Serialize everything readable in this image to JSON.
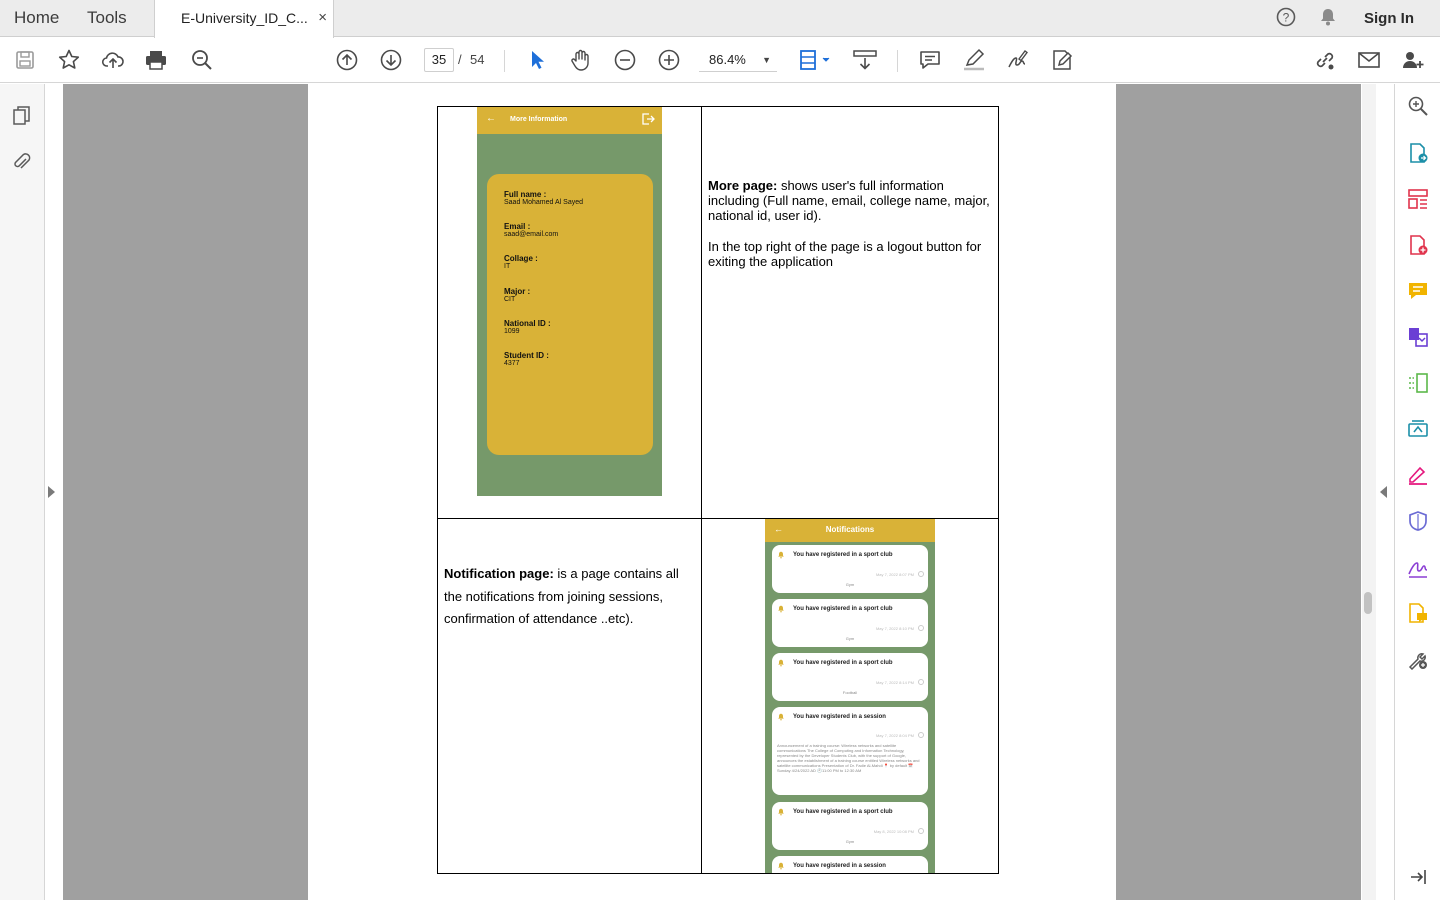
{
  "tabbar": {
    "home_label": "Home",
    "tools_label": "Tools",
    "doc_tab_label": "E-University_ID_C...",
    "close_glyph": "×",
    "sign_in_label": "Sign In",
    "icons": [
      "help-icon",
      "notifications-bell-icon"
    ]
  },
  "toolbar": {
    "current_page": "35",
    "page_separator": "/",
    "total_pages": "54",
    "zoom_level": "86.4%",
    "zoom_dropdown_glyph": "▼",
    "icons": [
      "save-icon",
      "bookmark-star-icon",
      "upload-cloud-icon",
      "print-icon",
      "zoom-search-icon",
      "prev-page-icon",
      "next-page-icon",
      "select-pointer-icon",
      "hand-tool-icon",
      "zoom-out-icon",
      "zoom-in-icon",
      "page-fit-icon",
      "scroll-mode-icon",
      "comment-icon",
      "highlight-icon",
      "sign-icon",
      "edit-icon",
      "share-link-icon",
      "email-icon",
      "add-user-icon"
    ]
  },
  "left_nav": {
    "icons": [
      "page-thumbnails-icon",
      "attachments-icon"
    ]
  },
  "right_panel": {
    "icons": [
      "search-zoom-icon",
      "export-pdf-icon",
      "organize-pages-icon",
      "create-pdf-icon",
      "comment-tool-icon",
      "combine-files-icon",
      "compress-icon",
      "scan-icon",
      "fill-sign-icon",
      "protect-icon",
      "request-signature-icon",
      "send-review-icon",
      "more-tools-icon",
      "expand-panel-icon"
    ]
  },
  "document": {
    "row1": {
      "phone": {
        "header_title": "More Information",
        "back_glyph": "←",
        "fields": [
          {
            "label": "Full name :",
            "value": "Saad Mohamed Al Sayed"
          },
          {
            "label": "Email :",
            "value": "saad@email.com"
          },
          {
            "label": "Collage :",
            "value": "IT"
          },
          {
            "label": "Major :",
            "value": "CIT"
          },
          {
            "label": "National ID :",
            "value": "1099"
          },
          {
            "label": "Student ID :",
            "value": "4377"
          }
        ]
      },
      "desc_title": "More page:",
      "desc_text": " shows user's full information including (Full name, email, college name, major, national id, user id).",
      "desc_text2": "In the top right of the page is a logout button for exiting the application"
    },
    "row2": {
      "desc_title": "Notification page:",
      "desc_text": " is a page contains all the notifications from joining sessions, confirmation of attendance ..etc).",
      "phone": {
        "header_title": "Notifications",
        "back_glyph": "←",
        "items": [
          {
            "title": "You have registered in a sport club",
            "date": "May 7, 2022 8:07 PM",
            "sub": "Gym"
          },
          {
            "title": "You have registered in a sport club",
            "date": "May 7, 2022 8:10 PM",
            "sub": "Gym"
          },
          {
            "title": "You have registered in a sport club",
            "date": "May 7, 2022 8:14 PM",
            "sub": "Football"
          },
          {
            "title": "You have registered in a session",
            "date": "May 7, 2022 8:04 PM",
            "sub": "",
            "body": "Announcement of a training course: Wireless networks and satellite communications The College of Computing and Information Technology, represented by the Developer Students Club, with the support of Google, announces the establishment of a training course entitled Wireless networks and satellite communications Presentation of Dr. Fadie Al-Mahdi 📍 by default 📅 Sunday 4/24/2022 AD 🕘11:00 PM to 12:30 AM"
          },
          {
            "title": "You have registered in a sport club",
            "date": "May 8, 2022 10:08 PM",
            "sub": "Gym"
          },
          {
            "title": "You have registered in a session",
            "date": "",
            "sub": ""
          }
        ]
      }
    }
  }
}
